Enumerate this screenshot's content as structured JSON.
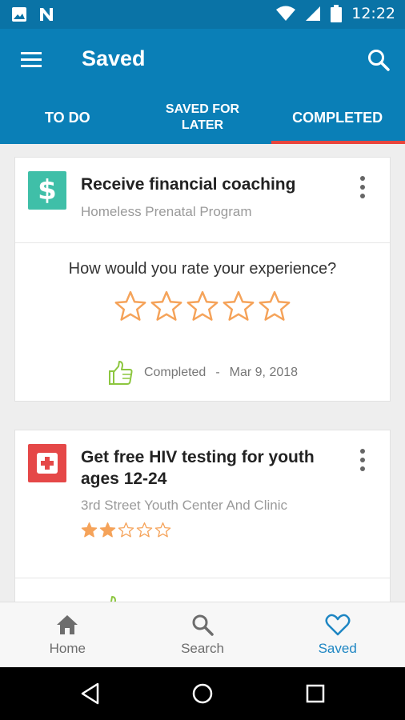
{
  "status_bar": {
    "time": "12:22"
  },
  "app_bar": {
    "title": "Saved"
  },
  "tabs": [
    {
      "label": "TO DO"
    },
    {
      "label": "SAVED FOR LATER"
    },
    {
      "label": "COMPLETED",
      "active": true
    }
  ],
  "cards": [
    {
      "title": "Receive financial coaching",
      "provider": "Homeless Prenatal Program",
      "icon": "dollar-icon",
      "icon_color": "#3fbfa8",
      "rating_prompt": "How would you rate your experience?",
      "rating": 0,
      "status": "Completed",
      "separator": "-",
      "date": "Mar 9, 2018"
    },
    {
      "title": "Get free HIV testing for youth ages 12-24",
      "provider": "3rd Street Youth Center And Clinic",
      "icon": "medical-cross-icon",
      "icon_color": "#e54848",
      "rating": 2,
      "rating_max": 5
    }
  ],
  "bottom_nav": [
    {
      "label": "Home",
      "icon": "home-icon"
    },
    {
      "label": "Search",
      "icon": "search-icon"
    },
    {
      "label": "Saved",
      "icon": "heart-icon",
      "active": true
    }
  ],
  "colors": {
    "primary": "#0a7fb7",
    "accent": "#e8453c",
    "star": "#f5a35a",
    "thumb": "#8cc63f"
  }
}
